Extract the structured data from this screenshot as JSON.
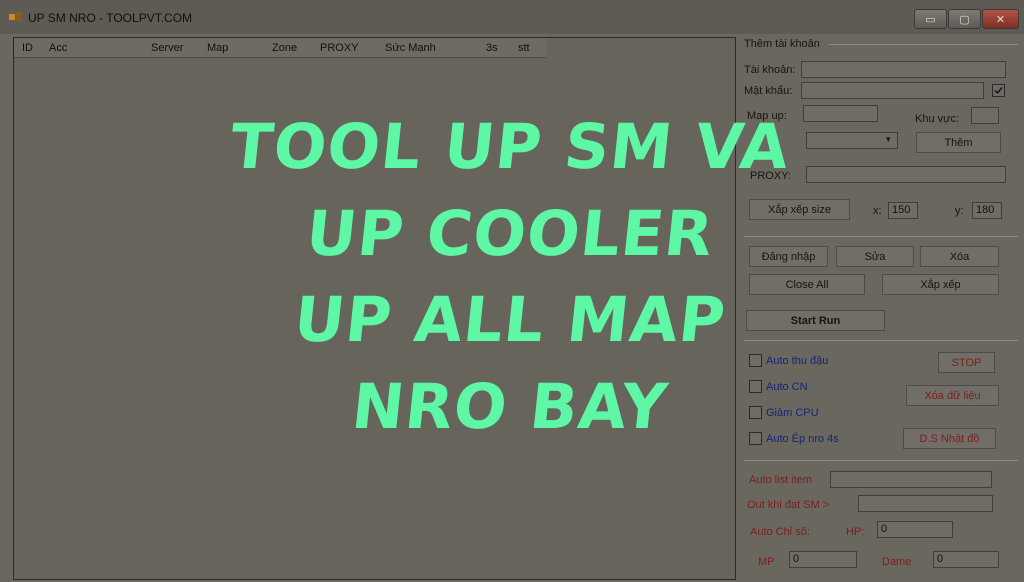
{
  "window": {
    "title": "UP SM NRO - TOOLPVT.COM",
    "controls": {
      "minimize": "▭",
      "maximize": "▢",
      "close": "✕"
    }
  },
  "grid": {
    "columns": [
      "ID",
      "Acc",
      "Server",
      "Map",
      "Zone",
      "PROXY",
      "Sức Mạnh",
      "3s",
      "stt"
    ]
  },
  "panel": {
    "group_title": "Thêm tài khoản",
    "account_label": "Tài khoản:",
    "account_value": "",
    "password_label": "Mật khẩu:",
    "password_value": "",
    "map_label": "Map up:",
    "map_value": "",
    "area_label": "Khu vực:",
    "area_value": "",
    "server_value": "",
    "add_button": "Thêm",
    "proxy_label": "PROXY:",
    "proxy_value": "",
    "arrange_size_button": "Xắp xếp size",
    "x_label": "x:",
    "x_value": "150",
    "y_label": "y:",
    "y_value": "180",
    "login_button": "Đăng nhập",
    "edit_button": "Sửa",
    "delete_button": "Xóa",
    "close_all_button": "Close All",
    "arrange_button": "Xắp xếp",
    "start_button": "Start Run",
    "auto_bean_label": "Auto thu đậu",
    "stop_button": "STOP",
    "auto_cn_label": "Auto CN",
    "clear_data_button": "Xóa dữ liệu",
    "reduce_cpu_label": "Giảm CPU",
    "auto_force_label": "Auto Ép nro 4s",
    "diary_button": "D.S Nhật đồ",
    "auto_list_label": "Auto list item",
    "auto_list_value": "",
    "out_label": "Out khi đạt SM >",
    "out_value": "",
    "auto_stat_label": "Auto Chỉ số:",
    "hp_label": "HP:",
    "hp_value": "0",
    "mp_label": "MP",
    "mp_value": "0",
    "dame_label": "Dame",
    "dame_value": "0"
  },
  "overlay": {
    "lines": [
      "TOOL UP SM VA",
      "UP COOLER",
      "UP ALL MAP",
      "NRO BAY"
    ],
    "color": "#5ef7a6"
  }
}
